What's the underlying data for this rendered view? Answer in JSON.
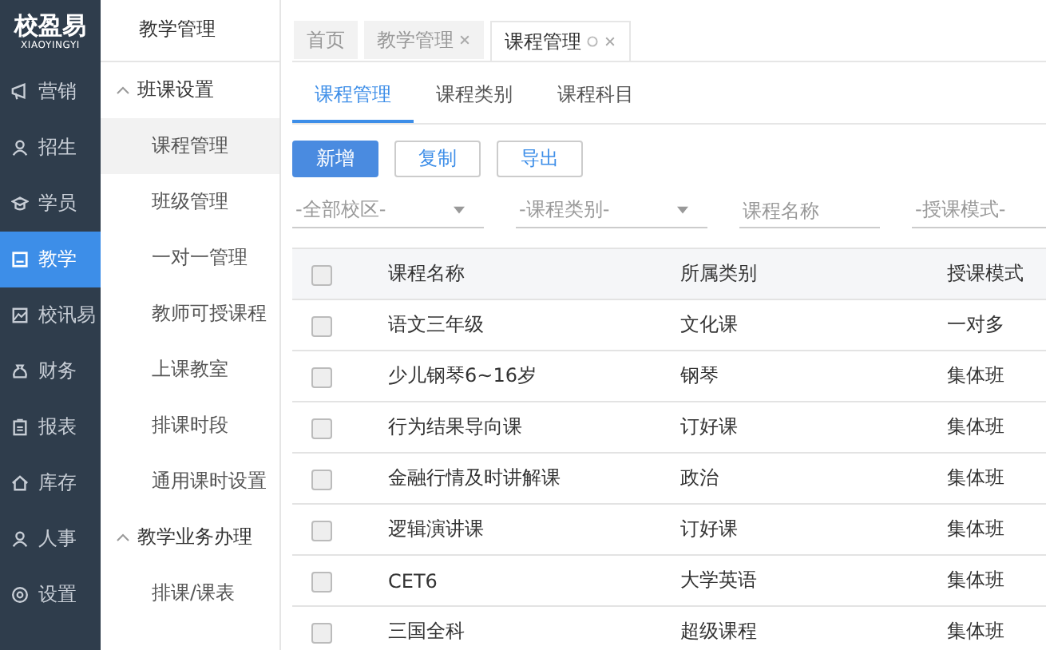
{
  "logo": {
    "title": "校盈易",
    "subtitle": "XIAOYINGYI"
  },
  "nav": [
    {
      "label": "营销",
      "selected": false
    },
    {
      "label": "招生",
      "selected": false
    },
    {
      "label": "学员",
      "selected": false
    },
    {
      "label": "教学",
      "selected": true
    },
    {
      "label": "校讯易",
      "selected": false
    },
    {
      "label": "财务",
      "selected": false
    },
    {
      "label": "报表",
      "selected": false
    },
    {
      "label": "库存",
      "selected": false
    },
    {
      "label": "人事",
      "selected": false
    },
    {
      "label": "设置",
      "selected": false
    }
  ],
  "submenu": {
    "title": "教学管理",
    "groups": [
      {
        "label": "班课设置",
        "expanded": true,
        "items": [
          {
            "label": "课程管理",
            "selected": true
          },
          {
            "label": "班级管理",
            "selected": false
          },
          {
            "label": "一对一管理",
            "selected": false
          },
          {
            "label": "教师可授课程",
            "selected": false
          },
          {
            "label": "上课教室",
            "selected": false
          },
          {
            "label": "排课时段",
            "selected": false
          },
          {
            "label": "通用课时设置",
            "selected": false
          }
        ]
      },
      {
        "label": "教学业务办理",
        "expanded": true,
        "items": [
          {
            "label": "排课/课表",
            "selected": false
          }
        ]
      }
    ]
  },
  "page_tabs": [
    {
      "label": "首页",
      "selected": false,
      "closable": false
    },
    {
      "label": "教学管理",
      "selected": false,
      "closable": true
    },
    {
      "label": "课程管理",
      "selected": true,
      "closable": true
    }
  ],
  "sub_tabs": [
    {
      "label": "课程管理",
      "selected": true
    },
    {
      "label": "课程类别",
      "selected": false
    },
    {
      "label": "课程科目",
      "selected": false
    }
  ],
  "buttons": [
    {
      "label": "新增",
      "kind": "primary"
    },
    {
      "label": "复制",
      "kind": "default"
    },
    {
      "label": "导出",
      "kind": "default"
    }
  ],
  "filters": [
    {
      "kind": "select",
      "placeholder": "-全部校区-"
    },
    {
      "kind": "select",
      "placeholder": "-课程类别-"
    },
    {
      "kind": "input",
      "placeholder": "课程名称"
    },
    {
      "kind": "select",
      "placeholder": "-授课模式-"
    }
  ],
  "table": {
    "columns": [
      "课程名称",
      "所属类别",
      "授课模式"
    ],
    "header_checked": false,
    "rows": [
      {
        "checked": false,
        "cells": [
          "语文三年级",
          "文化课",
          "一对多"
        ]
      },
      {
        "checked": false,
        "cells": [
          "少儿钢琴6~16岁",
          "钢琴",
          "集体班"
        ]
      },
      {
        "checked": false,
        "cells": [
          "行为结果导向课",
          "订好课",
          "集体班"
        ]
      },
      {
        "checked": false,
        "cells": [
          "金融行情及时讲解课",
          "政治",
          "集体班"
        ]
      },
      {
        "checked": false,
        "cells": [
          "逻辑演讲课",
          "订好课",
          "集体班"
        ]
      },
      {
        "checked": false,
        "cells": [
          "CET6",
          "大学英语",
          "集体班"
        ]
      },
      {
        "checked": false,
        "cells": [
          "三国全科",
          "超级课程",
          "集体班"
        ]
      }
    ]
  }
}
